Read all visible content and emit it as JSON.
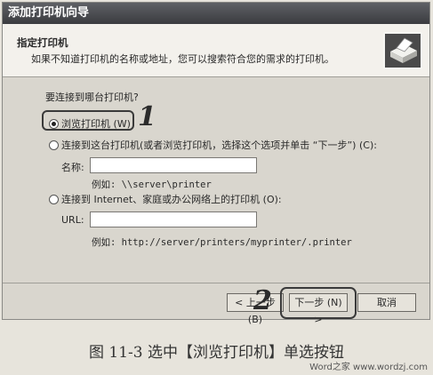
{
  "window": {
    "title": "添加打印机向导"
  },
  "header": {
    "title": "指定打印机",
    "subtitle": "如果不知道打印机的名称或地址，您可以搜索符合您的需求的打印机。",
    "icon": "printer-icon"
  },
  "body": {
    "question": "要连接到哪台打印机?",
    "options": [
      {
        "label": "浏览打印机 (W)",
        "checked": true
      },
      {
        "label": "连接到这台打印机(或者浏览打印机，选择这个选项并单击 “下一步”) (C):",
        "checked": false
      },
      {
        "label": "连接到 Internet、家庭或办公网络上的打印机 (O):",
        "checked": false
      }
    ],
    "name_field": {
      "label": "名称:",
      "value": "",
      "example": "例如: \\\\server\\printer"
    },
    "url_field": {
      "label": "URL:",
      "value": "",
      "example": "例如: http://server/printers/myprinter/.printer"
    }
  },
  "buttons": {
    "back": "< 上一步 (B)",
    "next": "下一步 (N) >",
    "cancel": "取消"
  },
  "annotations": {
    "marker1": "1",
    "marker2": "2"
  },
  "caption": "图 11-3   选中【浏览打印机】单选按钮",
  "watermark": "Word之家 www.wordzj.com"
}
